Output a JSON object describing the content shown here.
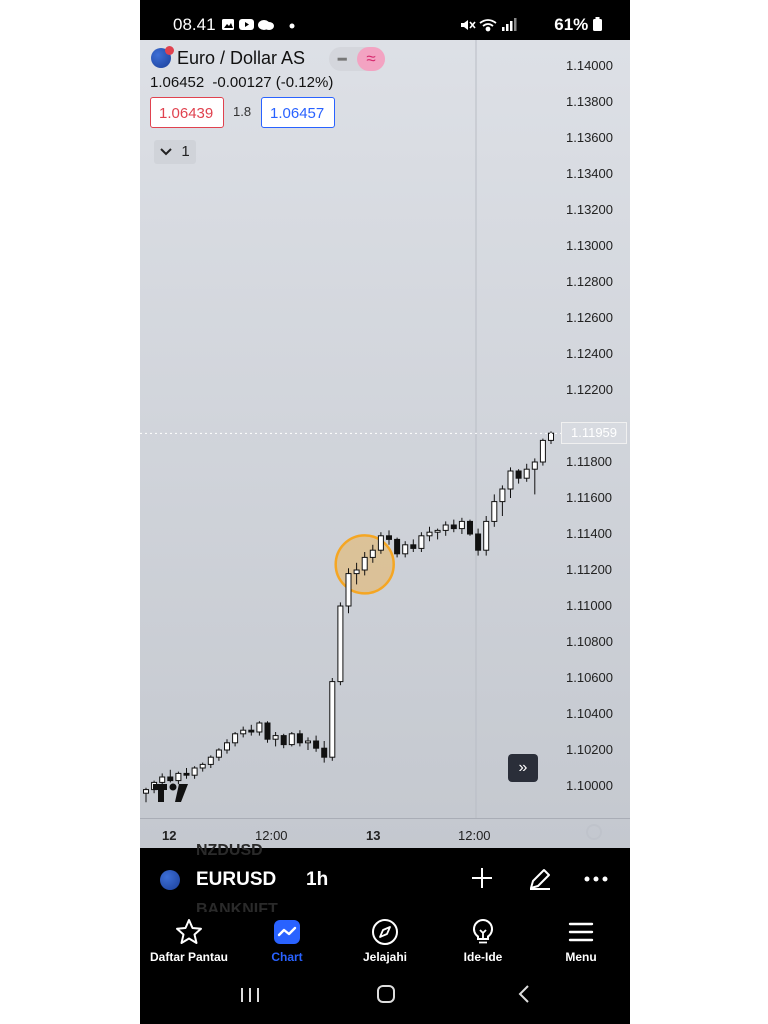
{
  "status_bar": {
    "time": "08.41",
    "battery": "61%",
    "left_icons": [
      "image-icon",
      "youtube-icon",
      "cloud-icon",
      "dot-icon"
    ],
    "right_icons": [
      "mute-icon",
      "wifi-icon",
      "signal-icon",
      "battery-icon"
    ]
  },
  "header": {
    "symbol_name": "Euro / Dollar AS",
    "last_price": "1.06452",
    "change": "-0.00127",
    "change_pct": "(-0.12%)",
    "bid": "1.06439",
    "spread": "1.8",
    "ask": "1.06457",
    "indicators_count": "1"
  },
  "chart_data": {
    "type": "candlestick",
    "price_axis": [
      "1.14000",
      "1.13800",
      "1.13600",
      "1.13400",
      "1.13200",
      "1.13000",
      "1.12800",
      "1.12600",
      "1.12400",
      "1.12200",
      "1.11800",
      "1.11600",
      "1.11400",
      "1.11200",
      "1.11000",
      "1.10800",
      "1.10600",
      "1.10400",
      "1.10200",
      "1.10000"
    ],
    "current_price_tag": "1.11959",
    "time_axis": [
      {
        "label": "12",
        "bold": true
      },
      {
        "label": "12:00",
        "bold": false
      },
      {
        "label": "13",
        "bold": true
      },
      {
        "label": "12:00",
        "bold": false
      }
    ],
    "ylim": [
      1.0926,
      1.1473
    ],
    "candles": [
      [
        1.0996,
        1.0999,
        1.0991,
        1.0998
      ],
      [
        1.0998,
        1.1003,
        1.0996,
        1.1002
      ],
      [
        1.1002,
        1.1007,
        1.1,
        1.1005
      ],
      [
        1.1005,
        1.1009,
        1.1002,
        1.1003
      ],
      [
        1.1003,
        1.1008,
        1.1001,
        1.1007
      ],
      [
        1.1007,
        1.101,
        1.1004,
        1.1006
      ],
      [
        1.1006,
        1.1011,
        1.1004,
        1.101
      ],
      [
        1.101,
        1.1013,
        1.1008,
        1.1012
      ],
      [
        1.1012,
        1.1017,
        1.101,
        1.1016
      ],
      [
        1.1016,
        1.1021,
        1.1014,
        1.102
      ],
      [
        1.102,
        1.1026,
        1.1018,
        1.1024
      ],
      [
        1.1024,
        1.103,
        1.1022,
        1.1029
      ],
      [
        1.1029,
        1.1033,
        1.1027,
        1.1031
      ],
      [
        1.1031,
        1.1034,
        1.1028,
        1.103
      ],
      [
        1.103,
        1.1036,
        1.1028,
        1.1035
      ],
      [
        1.1035,
        1.1036,
        1.1024,
        1.1026
      ],
      [
        1.1026,
        1.103,
        1.1022,
        1.1028
      ],
      [
        1.1028,
        1.1029,
        1.1021,
        1.1023
      ],
      [
        1.1023,
        1.103,
        1.1022,
        1.1029
      ],
      [
        1.1029,
        1.1031,
        1.1022,
        1.1024
      ],
      [
        1.1024,
        1.1027,
        1.102,
        1.1025
      ],
      [
        1.1025,
        1.1028,
        1.1019,
        1.1021
      ],
      [
        1.1021,
        1.1025,
        1.1013,
        1.1016
      ],
      [
        1.1016,
        1.106,
        1.1014,
        1.1058
      ],
      [
        1.1058,
        1.1102,
        1.1056,
        1.11
      ],
      [
        1.11,
        1.1121,
        1.1096,
        1.1118
      ],
      [
        1.1118,
        1.1124,
        1.1112,
        1.112
      ],
      [
        1.112,
        1.113,
        1.1117,
        1.1127
      ],
      [
        1.1127,
        1.1134,
        1.1124,
        1.1131
      ],
      [
        1.1131,
        1.1141,
        1.1129,
        1.1139
      ],
      [
        1.1139,
        1.1142,
        1.1134,
        1.1137
      ],
      [
        1.1137,
        1.1138,
        1.1127,
        1.1129
      ],
      [
        1.1129,
        1.1136,
        1.1127,
        1.1134
      ],
      [
        1.1134,
        1.1137,
        1.113,
        1.1132
      ],
      [
        1.1132,
        1.1141,
        1.113,
        1.1139
      ],
      [
        1.1139,
        1.1144,
        1.1136,
        1.1141
      ],
      [
        1.1141,
        1.1143,
        1.1137,
        1.1142
      ],
      [
        1.1142,
        1.1147,
        1.1139,
        1.1145
      ],
      [
        1.1145,
        1.1148,
        1.1141,
        1.1143
      ],
      [
        1.1143,
        1.1149,
        1.114,
        1.1147
      ],
      [
        1.1147,
        1.1148,
        1.1139,
        1.114
      ],
      [
        1.114,
        1.1143,
        1.1128,
        1.1131
      ],
      [
        1.1131,
        1.115,
        1.1128,
        1.1147
      ],
      [
        1.1147,
        1.1162,
        1.1144,
        1.1158
      ],
      [
        1.1158,
        1.1167,
        1.115,
        1.1165
      ],
      [
        1.1165,
        1.1177,
        1.116,
        1.1175
      ],
      [
        1.1175,
        1.1176,
        1.1168,
        1.1171
      ],
      [
        1.1171,
        1.1179,
        1.1169,
        1.1176
      ],
      [
        1.1176,
        1.1182,
        1.1162,
        1.118
      ],
      [
        1.118,
        1.1193,
        1.1178,
        1.1192
      ],
      [
        1.1192,
        1.1197,
        1.119,
        1.1196
      ]
    ],
    "highlight_marker": {
      "bar_index": 27,
      "price": 1.1122,
      "color": "#f5a623"
    }
  },
  "symbol_bar": {
    "symbol": "EURUSD",
    "interval": "1h",
    "ghost_above": "NZDUSD",
    "ghost_below": "BANKNIFT",
    "buttons": [
      "plus-icon",
      "pencil-icon",
      "more-icon"
    ]
  },
  "bottom_nav": [
    {
      "label": "Daftar Pantau",
      "icon": "star-icon",
      "active": false
    },
    {
      "label": "Chart",
      "icon": "chart-icon",
      "active": true
    },
    {
      "label": "Jelajahi",
      "icon": "compass-icon",
      "active": false
    },
    {
      "label": "Ide-Ide",
      "icon": "lightbulb-icon",
      "active": false
    },
    {
      "label": "Menu",
      "icon": "menu-icon",
      "active": false
    }
  ],
  "colors": {
    "accent": "#2962ff",
    "bid": "#e0424f",
    "ask": "#2962ff",
    "marker": "#f5a623"
  }
}
